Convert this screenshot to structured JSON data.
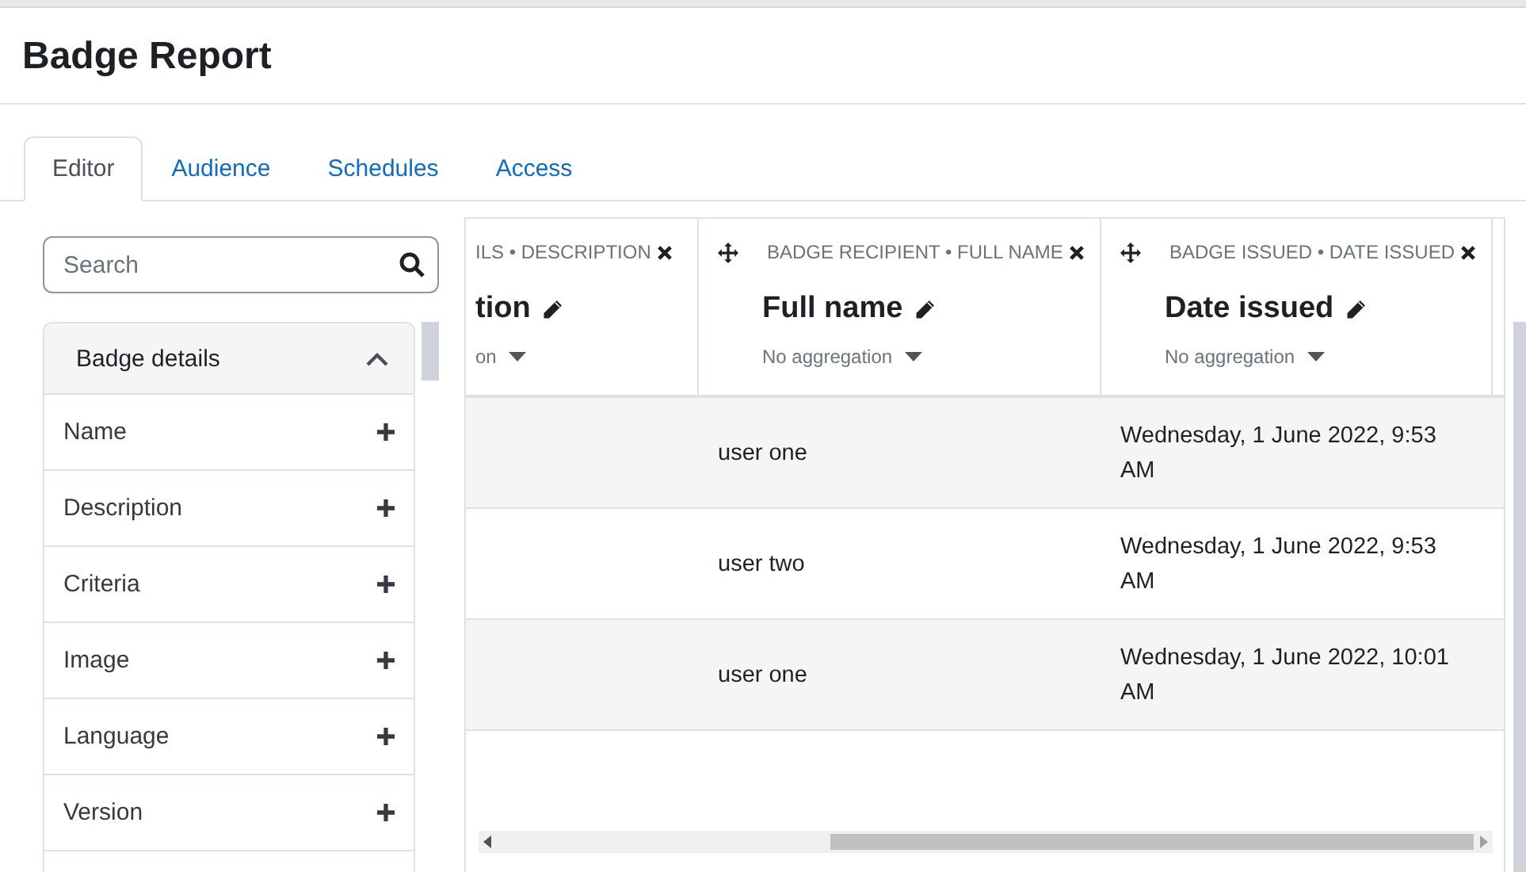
{
  "title": "Badge Report",
  "tabs": [
    {
      "label": "Editor",
      "selected": true
    },
    {
      "label": "Audience",
      "selected": false
    },
    {
      "label": "Schedules",
      "selected": false
    },
    {
      "label": "Access",
      "selected": false
    }
  ],
  "sidebar": {
    "search": {
      "placeholder": "Search"
    },
    "section": {
      "title": "Badge details",
      "expanded": true,
      "items": [
        "Name",
        "Description",
        "Criteria",
        "Image",
        "Language",
        "Version"
      ]
    }
  },
  "table": {
    "columns": [
      {
        "source": "ILS • DESCRIPTION",
        "title": "tion",
        "aggregation": "on"
      },
      {
        "source": "BADGE RECIPIENT • FULL NAME",
        "title": "Full name",
        "aggregation": "No aggregation"
      },
      {
        "source": "BADGE ISSUED • DATE ISSUED",
        "title": "Date issued",
        "aggregation": "No aggregation"
      }
    ],
    "rows": [
      {
        "full_name": "user one",
        "date_issued": "Wednesday, 1 June 2022, 9:53 AM"
      },
      {
        "full_name": "user two",
        "date_issued": "Wednesday, 1 June 2022, 9:53 AM"
      },
      {
        "full_name": "user one",
        "date_issued": "Wednesday, 1 June 2022, 10:01 AM"
      }
    ]
  }
}
